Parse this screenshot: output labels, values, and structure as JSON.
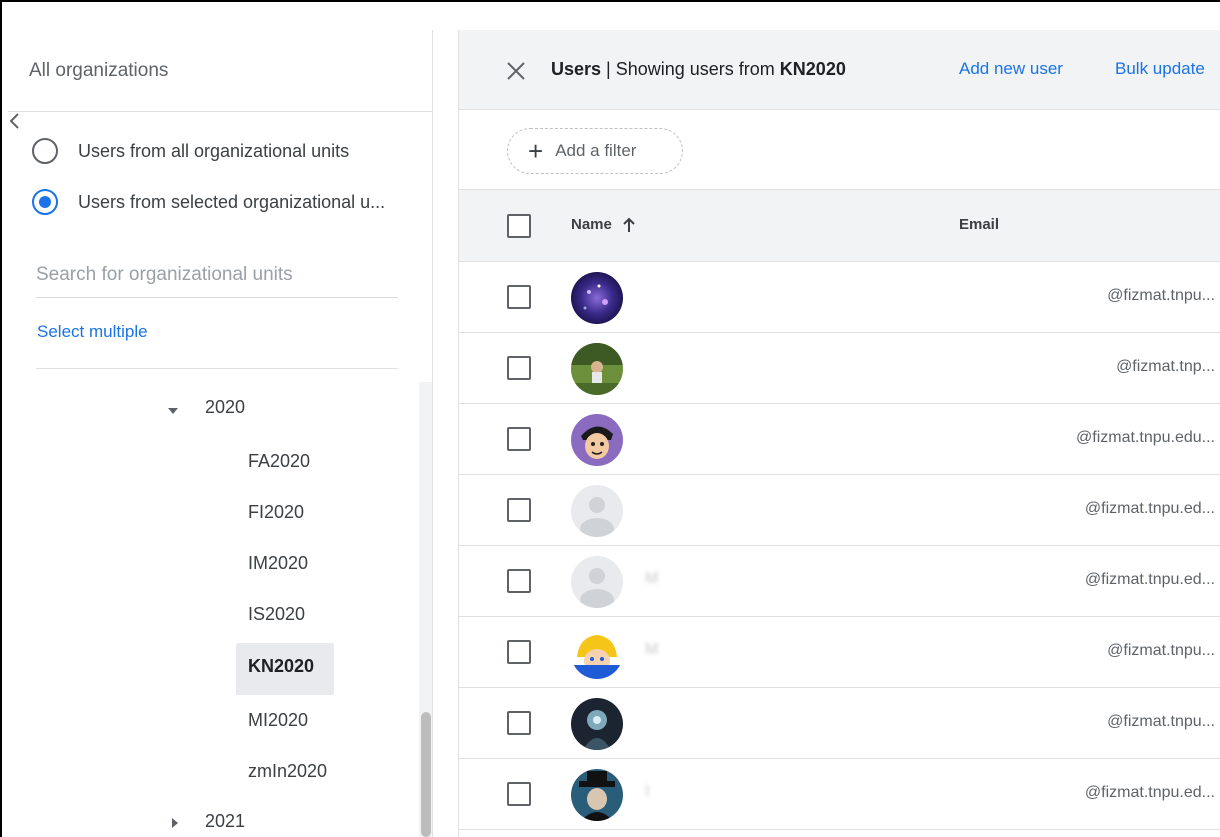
{
  "org_panel": {
    "title": "All organizations",
    "radio_all": "Users from all organizational units",
    "radio_selected": "Users from selected organizational u...",
    "search_placeholder": "Search for organizational units",
    "select_multiple": "Select multiple",
    "tree": {
      "parent": "2020",
      "children": [
        "FA2020",
        "FI2020",
        "IM2020",
        "IS2020",
        "KN2020",
        "MI2020",
        "zmIn2020"
      ],
      "selected": "KN2020",
      "next_parent": "2021"
    }
  },
  "users_panel": {
    "title_prefix": "Users",
    "title_sep": " | Showing users from ",
    "title_ou": "KN2020",
    "add_new_user": "Add new user",
    "bulk_update": "Bulk update",
    "add_filter": "Add a filter",
    "columns": {
      "name": "Name",
      "email": "Email"
    },
    "rows": [
      {
        "name": "",
        "email": "@fizmat.tnpu...",
        "avatar": "galaxy"
      },
      {
        "name": "",
        "email": "@fizmat.tnp...",
        "avatar": "outdoor"
      },
      {
        "name": "",
        "email": "@fizmat.tnpu.edu...",
        "avatar": "cartoon"
      },
      {
        "name": "",
        "email": "@fizmat.tnpu.ed...",
        "avatar": "default"
      },
      {
        "name": "M",
        "email": "@fizmat.tnpu.ed...",
        "avatar": "default"
      },
      {
        "name": "M",
        "email": "@fizmat.tnpu...",
        "avatar": "anime"
      },
      {
        "name": "",
        "email": "@fizmat.tnpu...",
        "avatar": "dark"
      },
      {
        "name": "I",
        "email": "@fizmat.tnpu.ed...",
        "avatar": "hat"
      }
    ]
  },
  "colors": {
    "accent": "#1a73e8",
    "header_bg": "#f1f3f4",
    "selected_bg": "#e8eaed"
  }
}
